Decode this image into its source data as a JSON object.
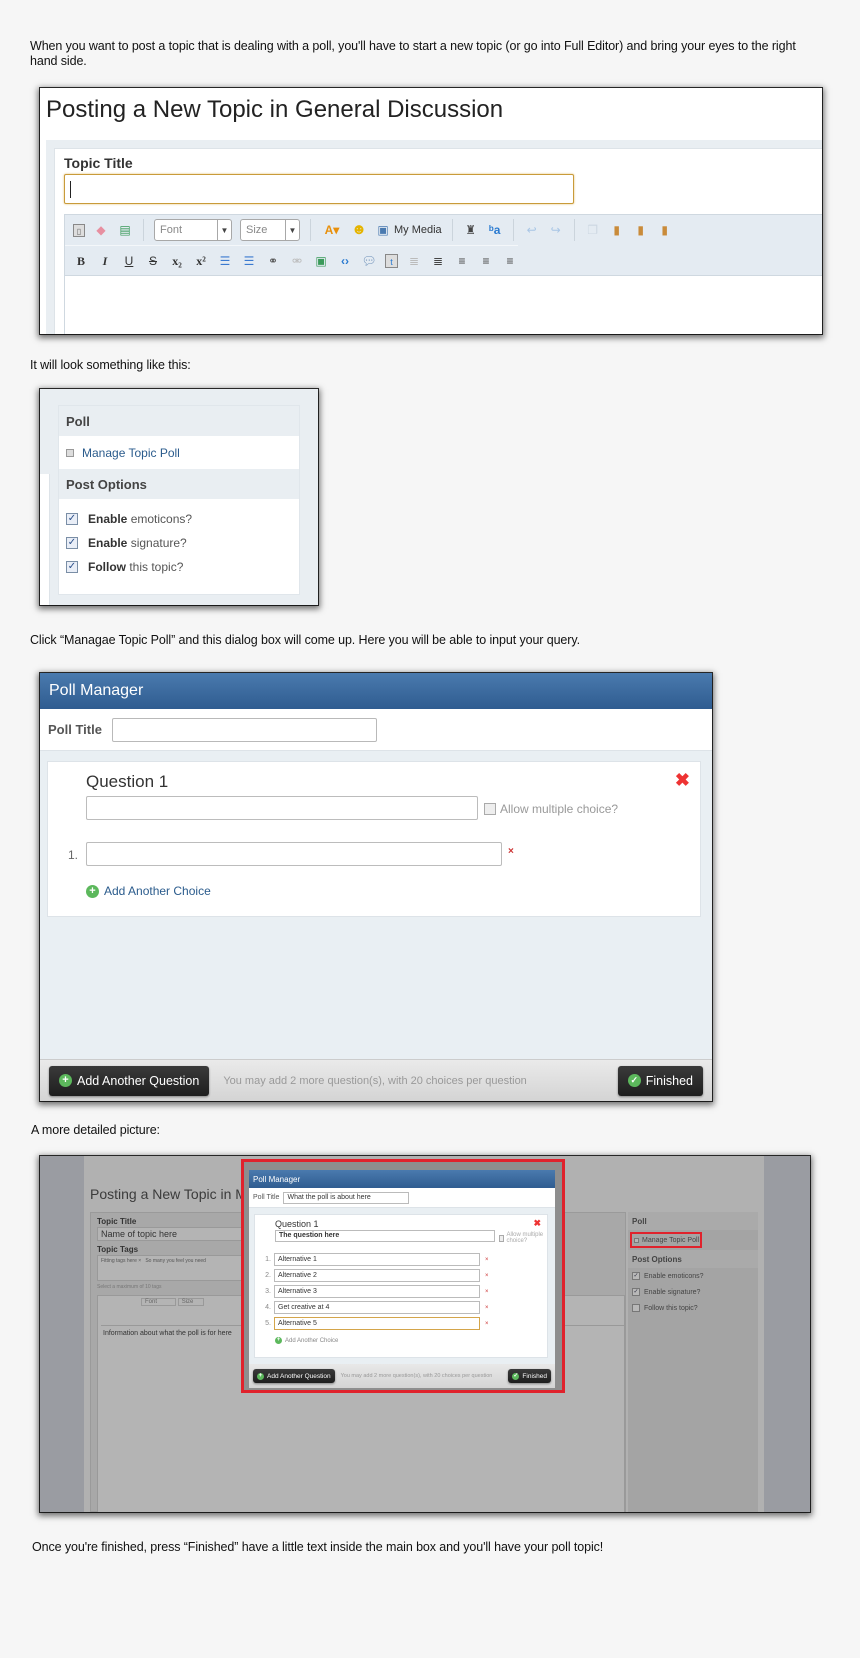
{
  "paragraphs": {
    "intro": "When you want to post a topic that is dealing with a poll, you'll have to start a new topic (or go into Full Editor) and bring your eyes to the right hand side.",
    "look_like": "It will look something like this:",
    "click_manage": "Click “Managae Topic Poll” and this dialog box will come up. Here you will be able to input your query.",
    "detailed": "A more detailed picture:",
    "finish": "Once you're finished, press “Finished” have a little text inside the main box and you'll have your poll topic!"
  },
  "screenshot1": {
    "page_title": "Posting a New Topic in General Discussion",
    "topic_title_label": "Topic Title",
    "topic_title_value": "",
    "toolbar_row1": {
      "icons": [
        "source-icon",
        "eraser-icon",
        "template-icon"
      ],
      "font_label": "Font",
      "size_label": "Size",
      "text_color_icon": "text-color-icon",
      "emoticon_icon": "smiley-icon",
      "my_media_label": "My Media",
      "more_icons": [
        "find-icon",
        "replace-icon",
        "undo-icon",
        "redo-icon",
        "copy-icon",
        "paste-icon",
        "paste-text-icon",
        "paste-word-icon"
      ]
    },
    "toolbar_row2": {
      "bold": "B",
      "italic": "I",
      "underline": "U",
      "strike": "S",
      "subscript": "x₂",
      "superscript": "x²"
    }
  },
  "screenshot2": {
    "poll_header": "Poll",
    "manage_link": "Manage Topic Poll",
    "post_options_header": "Post Options",
    "options": [
      {
        "bold": "Enable",
        "rest": " emoticons?",
        "checked": true
      },
      {
        "bold": "Enable",
        "rest": " signature?",
        "checked": true
      },
      {
        "bold": "Follow",
        "rest": " this topic?",
        "checked": true
      }
    ]
  },
  "poll_manager": {
    "title": "Poll Manager",
    "poll_title_label": "Poll Title",
    "poll_title_value": "",
    "question_label": "Question 1",
    "question_value": "",
    "allow_multiple_label": "Allow multiple choice?",
    "choice_number": "1.",
    "choice_value": "",
    "remove_choice": "×",
    "remove_question": "✖",
    "add_choice_label": "Add Another Choice",
    "add_question_label": "Add Another Question",
    "note": "You may add 2 more question(s), with 20 choices per question",
    "finished_label": "Finished"
  },
  "screenshot4": {
    "page_title": "Posting a New Topic in Mu",
    "topic_title_label": "Topic Title",
    "topic_title_value": "Name of topic here",
    "topic_tags_label": "Topic Tags",
    "tags": [
      "Fitting tags here ×",
      "So many you feel you need"
    ],
    "tags_hint": "Select a maximum of 10 tags",
    "font_label": "Font",
    "size_label": "Size",
    "body_text": "Information about what the poll is for here",
    "side": {
      "poll_header": "Poll",
      "manage_link": "Manage Topic Poll",
      "post_options_header": "Post Options",
      "options": [
        {
          "label": "Enable emoticons?",
          "checked": true
        },
        {
          "label": "Enable signature?",
          "checked": true
        },
        {
          "label": "Follow this topic?",
          "checked": false
        }
      ]
    },
    "poll": {
      "title": "Poll Manager",
      "poll_title_label": "Poll Title",
      "poll_title_value": "What the poll is about here",
      "question_label": "Question 1",
      "question_value": "The question here",
      "allow_multiple_label": "Allow multiple choice?",
      "choices": [
        {
          "n": "1.",
          "value": "Alternative 1"
        },
        {
          "n": "2.",
          "value": "Alternative 2"
        },
        {
          "n": "3.",
          "value": "Alternative 3"
        },
        {
          "n": "4.",
          "value": "Get creative at 4"
        },
        {
          "n": "5.",
          "value": "Alternative 5"
        }
      ],
      "add_choice_label": "Add Another Choice",
      "add_question_label": "Add Another Question",
      "note": "You may add 2 more question(s), with 20 choices per question",
      "finished_label": "Finished"
    },
    "highlight_color": "#e0222c"
  },
  "colors": {
    "header_blue": "#3a6a9f",
    "link_blue": "#2a5b8c",
    "add_green": "#5cb85c",
    "delete_red": "#e33333"
  }
}
